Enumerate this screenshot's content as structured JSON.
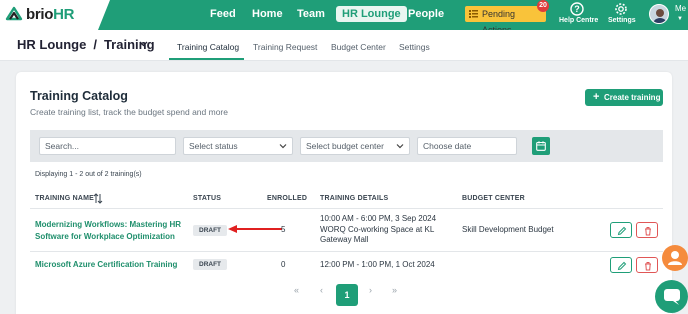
{
  "brand": {
    "logo_text": "brio",
    "logo_text_hr": "HR",
    "color": "#1f9e78"
  },
  "topnav": {
    "items": [
      {
        "label": "Feed"
      },
      {
        "label": "Home"
      },
      {
        "label": "Team"
      },
      {
        "label": "HR Lounge",
        "active": true
      },
      {
        "label": "People"
      }
    ],
    "pending_label": "Pending Actions",
    "pending_count": "20",
    "help_label": "Help Centre",
    "settings_label": "Settings",
    "user_label": "Me"
  },
  "subheader": {
    "crumb_root": "HR Lounge",
    "crumb_sep": "/",
    "crumb_current": "Training",
    "tabs": [
      {
        "label": "Training Catalog",
        "active": true
      },
      {
        "label": "Training Request"
      },
      {
        "label": "Budget Center"
      },
      {
        "label": "Settings"
      }
    ]
  },
  "catalog": {
    "title": "Training Catalog",
    "subtitle": "Create training list, track the budget spend and more",
    "create_label": "Create training",
    "filters": {
      "search_placeholder": "Search...",
      "status_placeholder": "Select status",
      "budget_placeholder": "Select budget center",
      "date_placeholder": "Choose date"
    },
    "displaying": "Displaying 1 - 2 out of 2 training(s)",
    "columns": [
      "TRAINING NAME",
      "STATUS",
      "ENROLLED",
      "TRAINING DETAILS",
      "BUDGET CENTER"
    ],
    "rows": [
      {
        "name_line1": "Modernizing Workflows: Mastering HR",
        "name_line2": "Software for Workplace Optimization",
        "status": "DRAFT",
        "enrolled": "5",
        "details_line1": "10:00 AM - 6:00 PM, 3 Sep 2024",
        "details_line2": "WORQ Co-working Space at KL",
        "details_line3": "Gateway Mall",
        "budget_center": "Skill Development Budget"
      },
      {
        "name_line1": "Microsoft Azure Certification Training",
        "status": "DRAFT",
        "enrolled": "0",
        "details_line1": "12:00 PM - 1:00 PM, 1 Oct 2024",
        "budget_center": ""
      }
    ]
  },
  "pagination": {
    "first": "«",
    "prev": "‹",
    "current": "1",
    "next": "›",
    "last": "»"
  },
  "colors": {
    "primary": "#1f9e78",
    "pending": "#f9c33a",
    "danger": "#e05656",
    "annotation_arrow": "#e02020",
    "fab_user": "#f58b3d"
  }
}
